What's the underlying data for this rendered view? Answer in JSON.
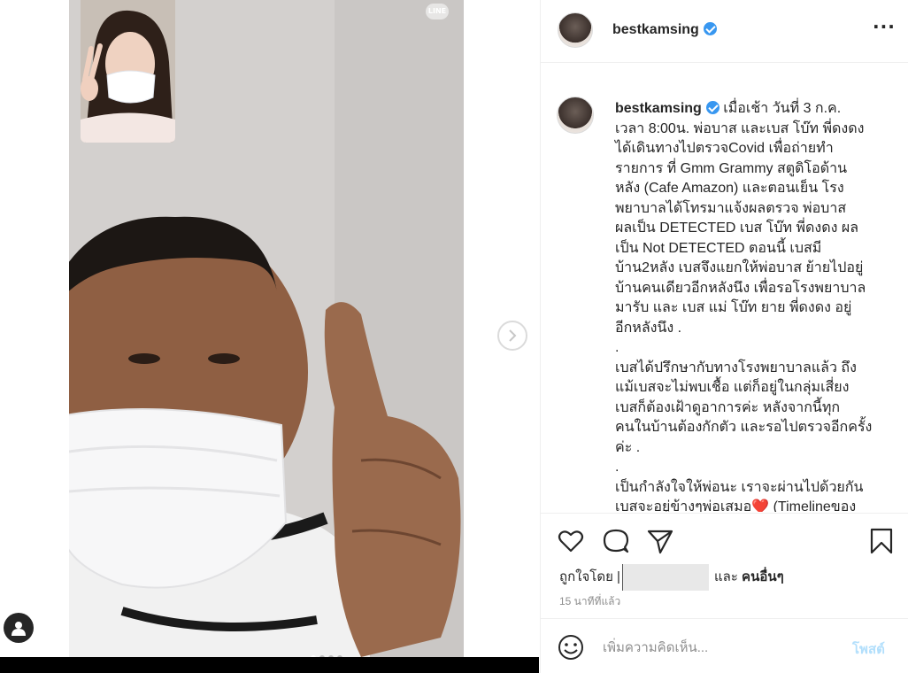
{
  "media": {
    "watermark": "LINE",
    "carousel_count": 4,
    "carousel_active_index": 0
  },
  "header": {
    "username": "bestkamsing",
    "verified": true,
    "more_icon": "more-horizontal-icon"
  },
  "caption": {
    "username": "bestkamsing",
    "text": "เมื่อเช้า วันที่ 3 ก.ค.\nเวลา 8:00น. พ่อบาส และเบส โบ๊ท พี่ดงดง\nได้เดินทางไปตรวจCovid เพื่อถ่ายทำ\nรายการ ที่ Gmm Grammy สตูดิโอด้าน\nหลัง (Cafe Amazon) และตอนเย็น โรง\nพยาบาลได้โทรมาแจ้งผลตรวจ พ่อบาส\nผลเป็น DETECTED เบส โบ๊ท พี่ดงดง ผล\nเป็น Not DETECTED ตอนนี้ เบสมี\nบ้าน2หลัง เบสจึงแยกให้พ่อบาส ย้ายไปอยู่\nบ้านคนเดียวอีกหลังนึง เพื่อรอโรงพยาบาล\nมารับ และ เบส แม่ โบ๊ท ยาย พี่ดงดง อยู่\nอีกหลังนึง .\n.\nเบสได้ปรึกษากับทางโรงพยาบาลแล้ว ถึง\nแม้เบสจะไม่พบเชื้อ แต่ก็อยู่ในกลุ่มเสี่ยง\nเบสก็ต้องเฝ้าดูอาการค่ะ หลังจากนี้ทุก\nคนในบ้านต้องกักตัว และรอไปตรวจอีกครั้ง\nค่ะ .\n.\nเป็นกำลังใจให้พ่อนะ เราจะผ่านไปด้วยกัน\nเบสจะอยู่ข้างๆพ่อเสมอ❤️ (Timelineของ"
  },
  "actions": {
    "like_icon": "heart-icon",
    "comment_icon": "comment-icon",
    "share_icon": "share-icon",
    "save_icon": "bookmark-icon"
  },
  "likes": {
    "prefix": "ถูกใจโดย",
    "first_liker": "|",
    "joiner": "และ",
    "others": "คนอื่นๆ"
  },
  "timestamp": "15 นาทีที่แล้ว",
  "comment_box": {
    "placeholder": "เพิ่มความคิดเห็น...",
    "post_label": "โพสต์",
    "emoji_icon": "smile-icon"
  },
  "colors": {
    "verified": "#3897f0",
    "post_disabled": "#b2dffc",
    "text": "#262626",
    "muted": "#8e8e8e"
  }
}
